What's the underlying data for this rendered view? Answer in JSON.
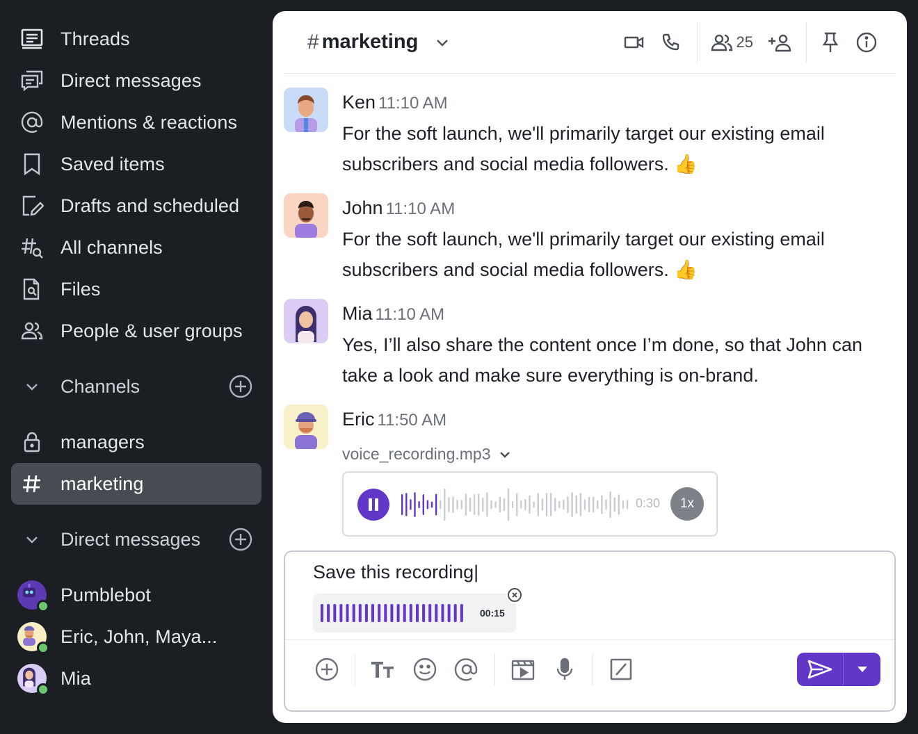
{
  "sidebar": {
    "nav": [
      {
        "label": "Threads",
        "icon": "threads-icon"
      },
      {
        "label": "Direct messages",
        "icon": "direct-messages-icon"
      },
      {
        "label": "Mentions & reactions",
        "icon": "at-icon"
      },
      {
        "label": "Saved items",
        "icon": "bookmark-icon"
      },
      {
        "label": "Drafts and scheduled",
        "icon": "draft-icon"
      },
      {
        "label": "All channels",
        "icon": "channel-search-icon"
      },
      {
        "label": "Files",
        "icon": "file-search-icon"
      },
      {
        "label": "People & user groups",
        "icon": "people-icon"
      }
    ],
    "channels_header": "Channels",
    "channels": [
      {
        "label": "managers",
        "icon": "lock-icon"
      },
      {
        "label": "marketing",
        "icon": "hash-icon"
      }
    ],
    "dm_header": "Direct messages",
    "dms": [
      {
        "label": "Pumblebot"
      },
      {
        "label": "Eric, John, Maya..."
      },
      {
        "label": "Mia"
      }
    ]
  },
  "channel": {
    "hash": "#",
    "name": "marketing",
    "member_count": "25"
  },
  "messages": [
    {
      "author": "Ken",
      "time": "11:10 AM",
      "text": "For the soft launch, we'll primarily target our existing email subscribers and social media followers. 👍"
    },
    {
      "author": "John",
      "time": "11:10 AM",
      "text": "For the soft launch, we'll primarily target our existing email subscribers and social media followers. 👍"
    },
    {
      "author": "Mia",
      "time": "11:10 AM",
      "text": "Yes, I’ll also share the content once I’m done, so that John can take a look and make sure everything is on-brand."
    },
    {
      "author": "Eric",
      "time": "11:50 AM"
    }
  ],
  "attachment": {
    "file_name": "voice_recording.mp3",
    "duration": "0:30",
    "speed": "1x",
    "played_fraction": 0.16
  },
  "composer": {
    "text": "Save this recording|",
    "recording_time": "00:15"
  },
  "colors": {
    "accent": "#6236c6",
    "sidebar_bg": "#1b1f24",
    "active_item": "#474c53",
    "online": "#6bc76b"
  }
}
